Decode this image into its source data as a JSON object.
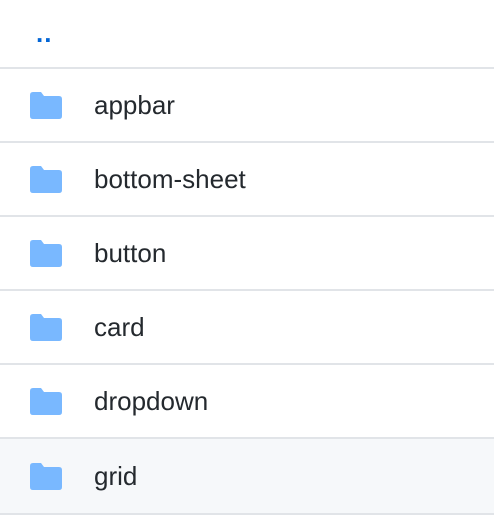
{
  "parent": {
    "label": ".."
  },
  "colors": {
    "folder_icon": "#79b8ff",
    "link": "#0366d6",
    "text": "#24292e",
    "border": "#e1e4e8",
    "hover_row": "#f6f8fa"
  },
  "items": [
    {
      "name": "appbar",
      "icon": "folder-icon"
    },
    {
      "name": "bottom-sheet",
      "icon": "folder-icon"
    },
    {
      "name": "button",
      "icon": "folder-icon"
    },
    {
      "name": "card",
      "icon": "folder-icon"
    },
    {
      "name": "dropdown",
      "icon": "folder-icon"
    },
    {
      "name": "grid",
      "icon": "folder-icon"
    }
  ]
}
